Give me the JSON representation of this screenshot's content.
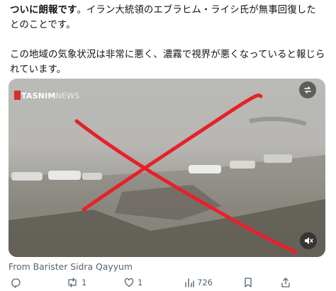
{
  "tweet": {
    "line1_bold": "ついに朗報です",
    "line1_rest": "。イラン大統領のエブラヒム・ライシ氏が無事回復した",
    "line2": "とのことです。",
    "para2": "この地域の気象状況は非常に悪く、濃霧で視界が悪くなっていると報じられています。"
  },
  "media": {
    "watermark_brand": "TASNIM",
    "watermark_suffix": "NEWS",
    "overlay_color": "#e8202a"
  },
  "attribution": "From Barister Sidra Qayyum",
  "actions": {
    "reply_count": "",
    "retweet_count": "1",
    "like_count": "1",
    "views_count": "726",
    "bookmark_count": "",
    "share_count": ""
  }
}
